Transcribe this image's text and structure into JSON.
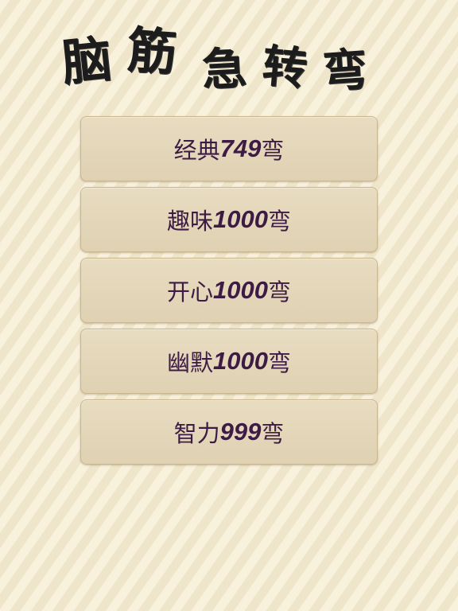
{
  "title": {
    "chars": [
      "脑",
      "筋",
      "急",
      "转",
      "弯"
    ]
  },
  "menu": {
    "items": [
      {
        "prefix": "经典",
        "number": "749",
        "suffix": "弯"
      },
      {
        "prefix": "趣味",
        "number": "1000",
        "suffix": "弯"
      },
      {
        "prefix": "开心",
        "number": "1000",
        "suffix": "弯"
      },
      {
        "prefix": "幽默",
        "number": "1000",
        "suffix": "弯"
      },
      {
        "prefix": "智力",
        "number": "999",
        "suffix": "弯"
      }
    ]
  },
  "colors": {
    "background": "#f7efd9",
    "button": "#e4d7bb",
    "button_border": "#c9b791",
    "button_text": "#3d1b45",
    "title_text": "#1c1c1c"
  }
}
